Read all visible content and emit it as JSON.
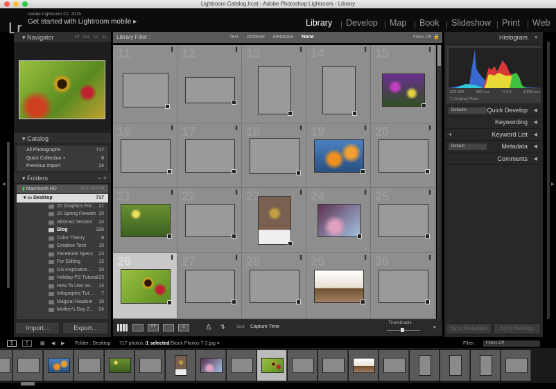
{
  "window_title": "Lightroom Catalog.lrcat - Adobe Photoshop Lightroom - Library",
  "identity": {
    "logo": "Lr",
    "version": "Adobe Lightroom CC 2015",
    "mobile": "Get started with Lightroom mobile ▸"
  },
  "modules": [
    {
      "label": "Library",
      "active": true
    },
    {
      "label": "Develop"
    },
    {
      "label": "Map"
    },
    {
      "label": "Book"
    },
    {
      "label": "Slideshow"
    },
    {
      "label": "Print"
    },
    {
      "label": "Web"
    }
  ],
  "navigator": {
    "title": "Navigator",
    "zoom": [
      "FIT",
      "FILL",
      "1:1",
      "3:1"
    ]
  },
  "catalog": {
    "title": "Catalog",
    "items": [
      {
        "label": "All Photographs",
        "count": "717"
      },
      {
        "label": "Quick Collection +",
        "count": "6"
      },
      {
        "label": "Previous Import",
        "count": "24"
      }
    ]
  },
  "folders": {
    "title": "Folders",
    "volume": "Macintosh HD",
    "volume_size": "37.2 / 112 GB",
    "root": "Desktop",
    "root_count": "717",
    "items": [
      {
        "label": "20 Graphics For...",
        "count": "21"
      },
      {
        "label": "20 Spring Flowers",
        "count": "20"
      },
      {
        "label": "Abstract Vectors",
        "count": "24"
      },
      {
        "label": "Blog",
        "count": "326"
      },
      {
        "label": "Color Theory",
        "count": "8"
      },
      {
        "label": "Creative Tech",
        "count": "10"
      },
      {
        "label": "Facebook Specs",
        "count": "23"
      },
      {
        "label": "For Editing",
        "count": "12"
      },
      {
        "label": "GS Inspiration...",
        "count": "20"
      },
      {
        "label": "Holiday PS Tutorial",
        "count": "23"
      },
      {
        "label": "How To Use Ve...",
        "count": "14"
      },
      {
        "label": "Infographic Tut...",
        "count": "7"
      },
      {
        "label": "Magical Realism",
        "count": "10"
      },
      {
        "label": "Mother's Day 2...",
        "count": "24"
      }
    ]
  },
  "import_label": "Import...",
  "export_label": "Export...",
  "filter_bar": {
    "title": "Library Filter :",
    "options": [
      "Text",
      "Attribute",
      "Metadata",
      "None"
    ],
    "active": "None",
    "status": "Filters Off"
  },
  "grid": {
    "cells": [
      11,
      12,
      13,
      14,
      15,
      16,
      17,
      18,
      19,
      20,
      21,
      22,
      23,
      24,
      25,
      26,
      27,
      28,
      29,
      30
    ],
    "selected": 26
  },
  "toolbar": {
    "sort_label": "Sort:",
    "sort_value": "Capture Time",
    "thumbnails_label": "Thumbnails"
  },
  "right": {
    "histogram_title": "Histogram",
    "iso": "ISO 800",
    "focal": "280 mm",
    "aperture": "f / 5.6",
    "shutter": "1/200 sec",
    "original_photo": "Original Photo",
    "sections": [
      {
        "label": "Quick Develop",
        "preset": "Defaults"
      },
      {
        "label": "Keywording"
      },
      {
        "label": "Keyword List",
        "plus": "+"
      },
      {
        "label": "Metadata",
        "preset": "Default"
      },
      {
        "label": "Comments"
      }
    ],
    "sync_metadata": "Sync Metadata",
    "sync_settings": "Sync Settings"
  },
  "filmstrip": {
    "screen1": "1",
    "screen2": "2",
    "folder": "Folder : Desktop",
    "count": "717 photos /",
    "selected": "1 selected",
    "file": "/Stock Photos 7-2.jpg ▾",
    "filter_label": "Filter :",
    "filter_value": "Filters Off"
  },
  "colors": {
    "accent": "#ffffff",
    "panel": "#282828",
    "grid": "#8e8e8e"
  }
}
